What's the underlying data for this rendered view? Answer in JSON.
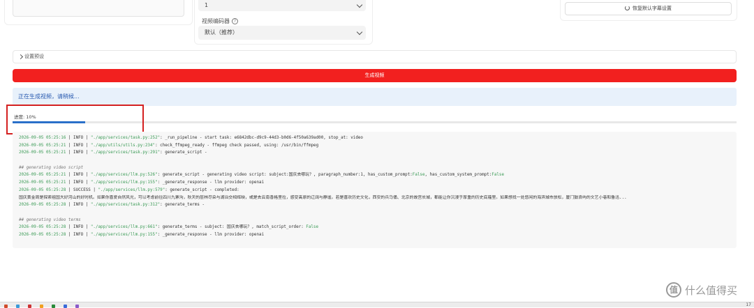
{
  "top": {
    "mid_select_value": "1",
    "codec_label": "视频编码器",
    "codec_help_icon": "?",
    "codec_select_value": "默认（推荐）",
    "restore_button_label": "恢复默认字幕设置"
  },
  "settings_row_label": "设置预设",
  "generate_button_label": "生成视频",
  "info_banner_text": "正在生成视频，请稍候...",
  "progress": {
    "label": "进度: 10%",
    "value": 10
  },
  "log": {
    "lines": [
      [
        {
          "t": "2026-09-05 05:25:16",
          "c": "time"
        },
        {
          "t": " | INFO | ",
          "c": ""
        },
        {
          "t": "\"./app/services/task.py:252\"",
          "c": "path"
        },
        {
          "t": ": _run_pipeline - start task: e6842dbc-d9c9-44d3-b0d6-4f50a639ad00, stop_at: video",
          "c": ""
        }
      ],
      [
        {
          "t": "2026-09-05 05:25:21",
          "c": "time"
        },
        {
          "t": " | INFO | ",
          "c": ""
        },
        {
          "t": "\"./app/utils/utils.py:234\"",
          "c": "path"
        },
        {
          "t": ": check_ffmpeg_ready - ffmpeg check passed, using: /usr/bin/ffmpeg",
          "c": ""
        }
      ],
      [
        {
          "t": "2026-09-05 05:25:21",
          "c": "time"
        },
        {
          "t": " | INFO | ",
          "c": ""
        },
        {
          "t": "\"./app/services/task.py:291\"",
          "c": "path"
        },
        {
          "t": ": generate_script -",
          "c": ""
        }
      ],
      [
        {
          "t": "",
          "c": ""
        }
      ],
      [
        {
          "t": "## generating video script",
          "c": "comment"
        }
      ],
      [
        {
          "t": "2026-09-05 05:25:21",
          "c": "time"
        },
        {
          "t": " | INFO | ",
          "c": ""
        },
        {
          "t": "\"./app/services/llm.py:526\"",
          "c": "path"
        },
        {
          "t": ": generate_script - generating video script: subject:国庆去哪玩？, paragraph_number:1, has_custom_prompt:",
          "c": ""
        },
        {
          "t": "False",
          "c": "false"
        },
        {
          "t": ", has_custom_system_prompt:",
          "c": ""
        },
        {
          "t": "False",
          "c": "false"
        }
      ],
      [
        {
          "t": "2026-09-05 05:25:21",
          "c": "time"
        },
        {
          "t": " | INFO | ",
          "c": ""
        },
        {
          "t": "\"./app/services/llm.py:155\"",
          "c": "path"
        },
        {
          "t": ": _generate_response - llm provider: openai",
          "c": ""
        }
      ],
      [
        {
          "t": "2026-09-05 05:25:28",
          "c": "time"
        },
        {
          "t": " | SUCCESS | ",
          "c": ""
        },
        {
          "t": "\"./app/services/llm.py:579\"",
          "c": "path"
        },
        {
          "t": ": generate_script - completed:",
          "c": ""
        }
      ],
      [
        {
          "t": "国庆黄金周是探索祖国大好河山的好时机。如果你喜爱自然风光，可以考虑前往四川九寨沟，秋天的层林尽染与湖泊交相辉映，或是去云南香格里拉，感受高原的辽阔与静谧。若是喜欢历史文化，西安的兵马俑、北京的故宫长城，都能让你沉浸于厚重的历史底蕴里。如果想找一处悠闲的海滨城市放松，厦门鼓浪屿的文艺小巷和鲁迅...",
          "c": ""
        }
      ],
      [
        {
          "t": "2026-09-05 05:25:28",
          "c": "time"
        },
        {
          "t": " | INFO | ",
          "c": ""
        },
        {
          "t": "\"./app/services/task.py:312\"",
          "c": "path"
        },
        {
          "t": ": generate_terms -",
          "c": ""
        }
      ],
      [
        {
          "t": "",
          "c": ""
        }
      ],
      [
        {
          "t": "## generating video terms",
          "c": "comment"
        }
      ],
      [
        {
          "t": "2026-09-05 05:25:28",
          "c": "time"
        },
        {
          "t": " | INFO | ",
          "c": ""
        },
        {
          "t": "\"./app/services/llm.py:661\"",
          "c": "path"
        },
        {
          "t": ": generate_terms - subject: 国庆去哪玩？, match_script_order: ",
          "c": ""
        },
        {
          "t": "False",
          "c": "false"
        }
      ],
      [
        {
          "t": "2026-09-05 05:25:28",
          "c": "time"
        },
        {
          "t": " | INFO | ",
          "c": ""
        },
        {
          "t": "\"./app/services/llm.py:155\"",
          "c": "path"
        },
        {
          "t": ": _generate_response - llm provider: openai",
          "c": ""
        }
      ]
    ]
  },
  "watermark": {
    "logo_glyph": "值",
    "text": "什么值得买"
  },
  "taskbar": {
    "clock_text": "17",
    "icons": [
      "#d04a2a",
      "#3a9ad9",
      "#cc3333",
      "#f0a020",
      "#2a8a3a",
      "#3a6ad9",
      "#8a5ac9"
    ]
  }
}
